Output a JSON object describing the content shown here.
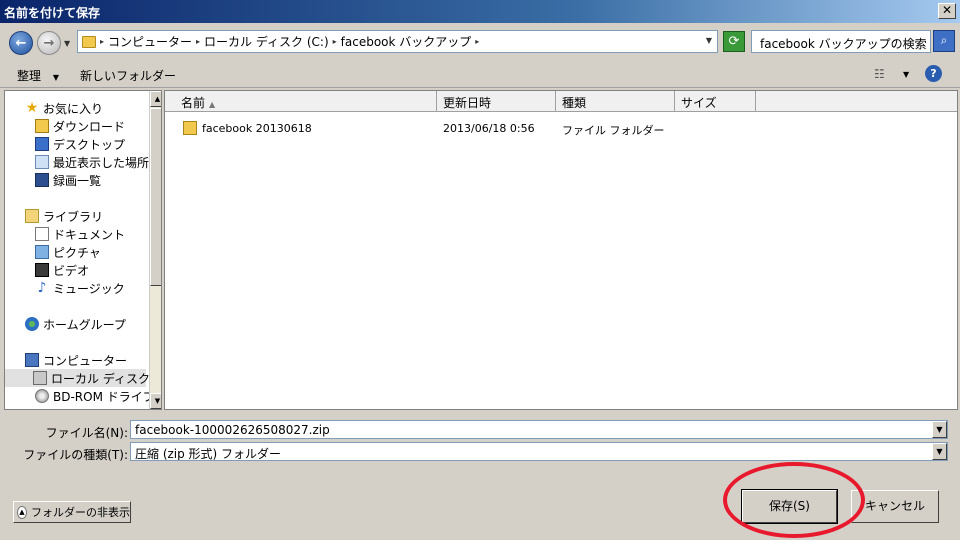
{
  "window": {
    "title": "名前を付けて保存",
    "close_glyph": "✕"
  },
  "address": {
    "back_glyph": "←",
    "forward_glyph": "→",
    "crumbs": [
      "コンピューター",
      "ローカル ディスク (C:)",
      "facebook バックアップ"
    ],
    "refresh_glyph": "⟳",
    "search_placeholder": "facebook バックアップの検索",
    "search_glyph": "⌕"
  },
  "toolbar": {
    "organize_label": "整理",
    "new_folder_label": "新しいフォルダー",
    "view_glyph": "☷",
    "help_glyph": "?"
  },
  "nav": {
    "items": [
      {
        "label": "お気に入り",
        "icon": "star-icon"
      },
      {
        "label": "ダウンロード",
        "icon": "downloads-icon"
      },
      {
        "label": "デスクトップ",
        "icon": "desktop-icon"
      },
      {
        "label": "最近表示した場所",
        "icon": "recent-places-icon"
      },
      {
        "label": "録画一覧",
        "icon": "recordings-icon"
      },
      {
        "label": "ライブラリ",
        "icon": "library-icon"
      },
      {
        "label": "ドキュメント",
        "icon": "documents-icon"
      },
      {
        "label": "ピクチャ",
        "icon": "pictures-icon"
      },
      {
        "label": "ビデオ",
        "icon": "videos-icon"
      },
      {
        "label": "ミュージック",
        "icon": "music-icon"
      },
      {
        "label": "ホームグループ",
        "icon": "homegroup-icon"
      },
      {
        "label": "コンピューター",
        "icon": "computer-icon"
      },
      {
        "label": "ローカル ディスク (C",
        "icon": "local-disk-icon"
      },
      {
        "label": "BD-ROM ドライブ",
        "icon": "bd-rom-icon"
      }
    ]
  },
  "files": {
    "columns": [
      "名前",
      "更新日時",
      "種類",
      "サイズ"
    ],
    "rows": [
      {
        "name": "facebook 20130618",
        "modified": "2013/06/18 0:56",
        "type": "ファイル フォルダー",
        "size": ""
      }
    ]
  },
  "form": {
    "filename_label": "ファイル名(N):",
    "filename_value": "facebook-100002626508027.zip",
    "filetype_label": "ファイルの種類(T):",
    "filetype_value": "圧縮 (zip 形式) フォルダー"
  },
  "footer": {
    "hide_folders_label": "フォルダーの非表示",
    "save_label": "保存(S)",
    "cancel_label": "キャンセル"
  },
  "colors": {
    "annotation": "#e8192c"
  }
}
